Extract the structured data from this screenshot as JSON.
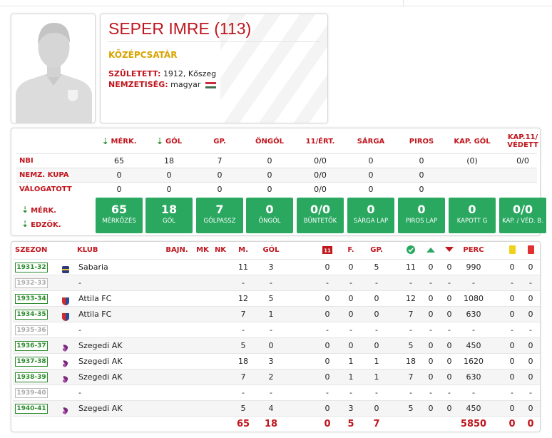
{
  "player": {
    "name": "SEPER IMRE (113)",
    "position": "KÖZÉPCSATÁR",
    "born_label": "SZÜLETETT:",
    "born_value": "1912, Kőszeg",
    "nationality_label": "NEMZETISÉG:",
    "nationality_value": "magyar",
    "flag_colors": [
      "#cd2a3e",
      "#ffffff",
      "#436f4d"
    ],
    "avatar_icon": "person-silhouette-icon"
  },
  "stats": {
    "headers": [
      "MÉRK.",
      "GÓL",
      "GP.",
      "ÖNGÓL",
      "11/ÉRT.",
      "SÁRGA",
      "PIROS",
      "KAP. GÓL",
      "KAP.11/ VÉDETT"
    ],
    "rows": [
      {
        "label": "NBI",
        "values": [
          "65",
          "18",
          "7",
          "0",
          "0/0",
          "0",
          "0",
          "(0)",
          "0/0"
        ]
      },
      {
        "label": "NEMZ. KUPA",
        "values": [
          "0",
          "0",
          "0",
          "0",
          "0/0",
          "0",
          "0",
          "",
          ""
        ]
      },
      {
        "label": "VÁLOGATOTT",
        "values": [
          "0",
          "0",
          "0",
          "0",
          "0/0",
          "0",
          "0",
          "",
          ""
        ]
      }
    ],
    "sort_labels": [
      "MÉRK.",
      "EDZŐK."
    ],
    "boxes": [
      {
        "value": "65",
        "caption": "MÉRKŐZÉS"
      },
      {
        "value": "18",
        "caption": "GÓL"
      },
      {
        "value": "7",
        "caption": "GÓLPASSZ"
      },
      {
        "value": "0",
        "caption": "ÖNGÓL"
      },
      {
        "value": "0/0",
        "caption": "BÜNTETŐK"
      },
      {
        "value": "0",
        "caption": "SÁRGA LAP"
      },
      {
        "value": "0",
        "caption": "PIROS LAP"
      },
      {
        "value": "0",
        "caption": "KAPOTT G"
      },
      {
        "value": "0/0",
        "caption": "KAP. / VÉD. B."
      }
    ]
  },
  "seasons": {
    "headers": {
      "season": "SZEZON",
      "club": "KLUB",
      "bajn": "BAJN.",
      "mk": "MK",
      "nk": "NK",
      "m": "M.",
      "gol": "GÓL",
      "pen_icon_text": "11",
      "f": "F.",
      "gp": "GP.",
      "perc": "PERC"
    },
    "icons": {
      "win": "check-circle-icon",
      "draw": "triangle-up-icon",
      "loss": "triangle-down-icon",
      "yellow": "yellow-card-icon",
      "red": "red-card-icon"
    },
    "rows": [
      {
        "season": "1931-32",
        "active": true,
        "club": "Sabaria",
        "crest": "sabaria",
        "m": "11",
        "gol": "3",
        "p": "0",
        "f": "0",
        "gp": "5",
        "w": "11",
        "d": "0",
        "l": "0",
        "perc": "990",
        "y": "0",
        "r": "0"
      },
      {
        "season": "1932-33",
        "active": false,
        "club": "-",
        "crest": "",
        "m": "-",
        "gol": "-",
        "p": "-",
        "f": "-",
        "gp": "-",
        "w": "-",
        "d": "-",
        "l": "-",
        "perc": "-",
        "y": "-",
        "r": "-"
      },
      {
        "season": "1933-34",
        "active": true,
        "club": "Attila FC",
        "crest": "attila",
        "m": "12",
        "gol": "5",
        "p": "0",
        "f": "0",
        "gp": "0",
        "w": "12",
        "d": "0",
        "l": "0",
        "perc": "1080",
        "y": "0",
        "r": "0"
      },
      {
        "season": "1934-35",
        "active": true,
        "club": "Attila FC",
        "crest": "attila",
        "m": "7",
        "gol": "1",
        "p": "0",
        "f": "0",
        "gp": "0",
        "w": "7",
        "d": "0",
        "l": "0",
        "perc": "630",
        "y": "0",
        "r": "0"
      },
      {
        "season": "1935-36",
        "active": false,
        "club": "-",
        "crest": "",
        "m": "-",
        "gol": "-",
        "p": "-",
        "f": "-",
        "gp": "-",
        "w": "-",
        "d": "-",
        "l": "-",
        "perc": "-",
        "y": "-",
        "r": "-"
      },
      {
        "season": "1936-37",
        "active": true,
        "club": "Szegedi AK",
        "crest": "szak",
        "m": "5",
        "gol": "0",
        "p": "0",
        "f": "0",
        "gp": "0",
        "w": "5",
        "d": "0",
        "l": "0",
        "perc": "450",
        "y": "0",
        "r": "0"
      },
      {
        "season": "1937-38",
        "active": true,
        "club": "Szegedi AK",
        "crest": "szak",
        "m": "18",
        "gol": "3",
        "p": "0",
        "f": "1",
        "gp": "1",
        "w": "18",
        "d": "0",
        "l": "0",
        "perc": "1620",
        "y": "0",
        "r": "0"
      },
      {
        "season": "1938-39",
        "active": true,
        "club": "Szegedi AK",
        "crest": "szak",
        "m": "7",
        "gol": "2",
        "p": "0",
        "f": "1",
        "gp": "1",
        "w": "7",
        "d": "0",
        "l": "0",
        "perc": "630",
        "y": "0",
        "r": "0"
      },
      {
        "season": "1939-40",
        "active": false,
        "club": "-",
        "crest": "",
        "m": "-",
        "gol": "-",
        "p": "-",
        "f": "-",
        "gp": "-",
        "w": "-",
        "d": "-",
        "l": "-",
        "perc": "-",
        "y": "-",
        "r": "-"
      },
      {
        "season": "1940-41",
        "active": true,
        "club": "Szegedi AK",
        "crest": "szak",
        "m": "5",
        "gol": "4",
        "p": "0",
        "f": "3",
        "gp": "0",
        "w": "5",
        "d": "0",
        "l": "0",
        "perc": "450",
        "y": "0",
        "r": "0"
      }
    ],
    "totals": {
      "m": "65",
      "gol": "18",
      "p": "0",
      "f": "5",
      "gp": "7",
      "perc": "5850",
      "y": "0",
      "r": "0"
    }
  }
}
